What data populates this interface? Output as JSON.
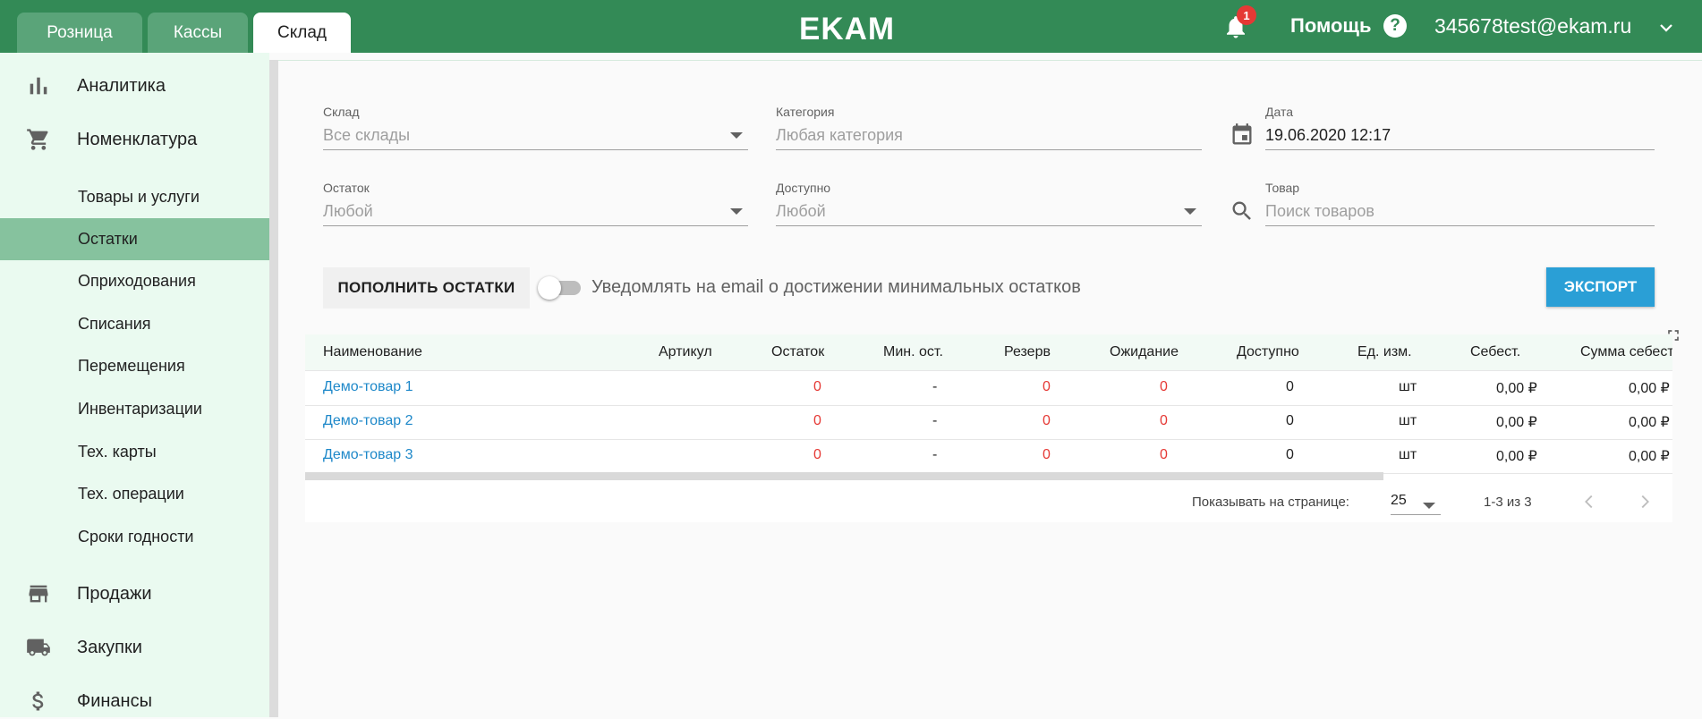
{
  "header": {
    "tabs": [
      {
        "label": "Розница",
        "active": false
      },
      {
        "label": "Кассы",
        "active": false
      },
      {
        "label": "Склад",
        "active": true
      }
    ],
    "logo": "EKAM",
    "notifications_count": "1",
    "help_label": "Помощь",
    "help_icon": "?",
    "user_email": "345678test@ekam.ru",
    "accent_color": "#338a56"
  },
  "sidebar": {
    "analytics": "Аналитика",
    "nomenclature": "Номенклатура",
    "sub_items": [
      "Товары и услуги",
      "Остатки",
      "Оприходования",
      "Списания",
      "Перемещения",
      "Инвентаризации",
      "Тех. карты",
      "Тех. операции",
      "Сроки годности"
    ],
    "active_sub": "Остатки",
    "sales": "Продажи",
    "purchases": "Закупки",
    "finance": "Финансы"
  },
  "filters": {
    "warehouse": {
      "label": "Склад",
      "value": "Все склады"
    },
    "category": {
      "label": "Категория",
      "placeholder": "Любая категория"
    },
    "date": {
      "label": "Дата",
      "value": "19.06.2020 12:17"
    },
    "remainder": {
      "label": "Остаток",
      "value": "Любой"
    },
    "available": {
      "label": "Доступно",
      "value": "Любой"
    },
    "product": {
      "label": "Товар",
      "placeholder": "Поиск товаров"
    }
  },
  "actions": {
    "replenish_label": "ПОПОЛНИТЬ ОСТАТКИ",
    "notify_label": "Уведомлять на email о достижении минимальных остатков",
    "notify_enabled": false,
    "export_label": "ЭКСПОРТ"
  },
  "table": {
    "columns": [
      "Наименование",
      "Артикул",
      "Остаток",
      "Мин. ост.",
      "Резерв",
      "Ожидание",
      "Доступно",
      "Ед. изм.",
      "Себест.",
      "Сумма себест"
    ],
    "rows": [
      [
        "Демо-товар 1",
        "",
        "0",
        "-",
        "0",
        "0",
        "0",
        "шт",
        "0,00 ₽",
        "0,00 ₽"
      ],
      [
        "Демо-товар 2",
        "",
        "0",
        "-",
        "0",
        "0",
        "0",
        "шт",
        "0,00 ₽",
        "0,00 ₽"
      ],
      [
        "Демо-товар 3",
        "",
        "0",
        "-",
        "0",
        "0",
        "0",
        "шт",
        "0,00 ₽",
        "0,00 ₽"
      ]
    ],
    "per_page_label": "Показывать на странице:",
    "per_page_value": "25",
    "range_label": "1-3 из 3"
  }
}
